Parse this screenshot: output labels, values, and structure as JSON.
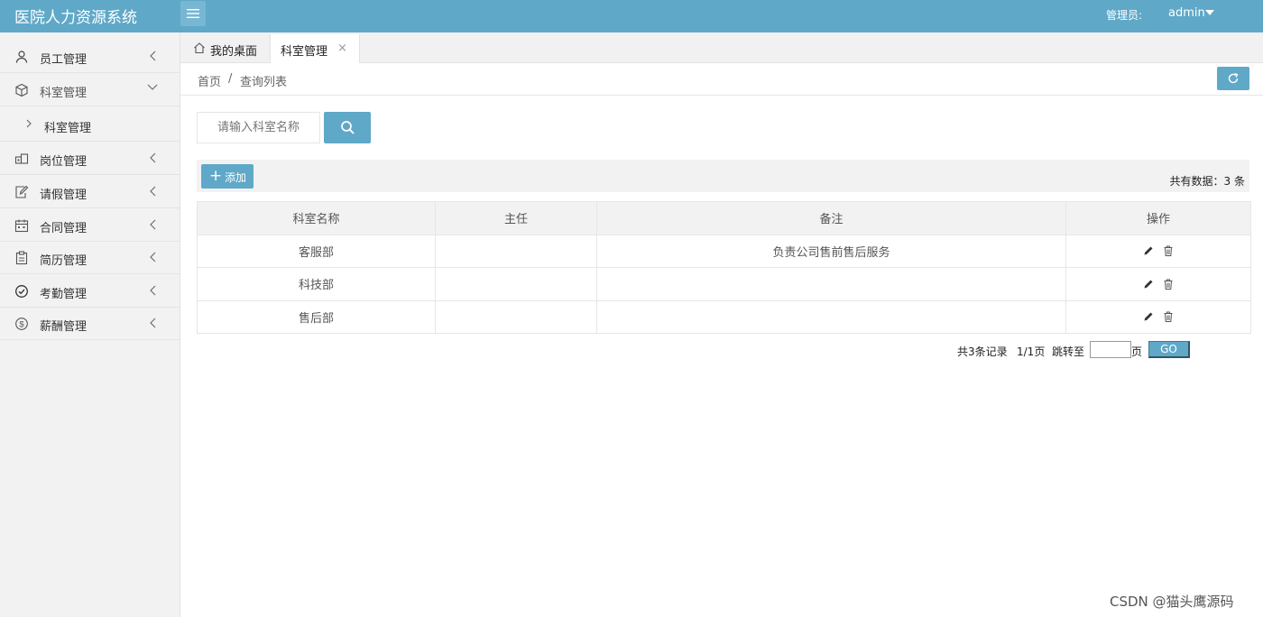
{
  "header": {
    "app_title": "医院人力资源系统",
    "admin_label": "管理员:",
    "admin_name": "admin",
    "menu_icon": "hamburger-icon",
    "dropdown_icon": "caret-down-icon"
  },
  "sidebar": {
    "items": [
      {
        "label": "员工管理",
        "icon": "user-icon",
        "expanded": false
      },
      {
        "label": "科室管理",
        "icon": "cube-icon",
        "expanded": true,
        "children": [
          {
            "label": "科室管理"
          }
        ]
      },
      {
        "label": "岗位管理",
        "icon": "building-icon",
        "expanded": false
      },
      {
        "label": "请假管理",
        "icon": "edit-doc-icon",
        "expanded": false
      },
      {
        "label": "合同管理",
        "icon": "calendar-icon",
        "expanded": false
      },
      {
        "label": "简历管理",
        "icon": "clipboard-icon",
        "expanded": false
      },
      {
        "label": "考勤管理",
        "icon": "check-circle-icon",
        "expanded": false
      },
      {
        "label": "薪酬管理",
        "icon": "dollar-circle-icon",
        "expanded": false
      }
    ]
  },
  "tabs": {
    "home": {
      "label": "我的桌面",
      "icon": "home-icon"
    },
    "active": {
      "label": "科室管理",
      "close": "×"
    }
  },
  "breadcrumb": {
    "home": "首页",
    "sep": "/",
    "current": "查询列表",
    "refresh_icon": "refresh-icon"
  },
  "search": {
    "placeholder": "请输入科室名称",
    "value": "",
    "button_icon": "search-icon"
  },
  "toolbar": {
    "add_label": "添加",
    "total_text": "共有数据：3 条"
  },
  "table": {
    "columns": [
      "科室名称",
      "主任",
      "备注",
      "操作"
    ],
    "rows": [
      {
        "name": "客服部",
        "director": "",
        "note": "负责公司售前售后服务"
      },
      {
        "name": "科技部",
        "director": "",
        "note": ""
      },
      {
        "name": "售后部",
        "director": "",
        "note": ""
      }
    ],
    "action_icons": [
      "edit-icon",
      "trash-icon"
    ]
  },
  "pagination": {
    "summary": "共3条记录",
    "page_info": "1/1页",
    "jump_label": "跳转至",
    "page_suffix": "页",
    "go_label": "GO",
    "jump_value": ""
  },
  "watermark": "CSDN @猫头鹰源码",
  "colors": {
    "accent": "#5fa8c8",
    "sidebar_bg": "#f2f2f2",
    "header_text": "#ffffff"
  }
}
